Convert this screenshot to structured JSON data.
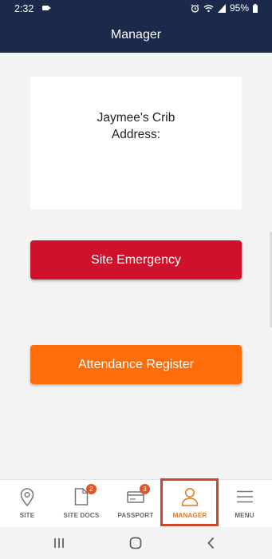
{
  "status_bar": {
    "time": "2:32",
    "battery": "95%",
    "icons": [
      "video-record-icon",
      "alarm-icon",
      "wifi-icon",
      "signal-icon",
      "battery-icon"
    ]
  },
  "header": {
    "title": "Manager"
  },
  "site_card": {
    "site_name": "Jaymee's Crib",
    "address_label": "Address:"
  },
  "buttons": {
    "emergency": "Site Emergency",
    "attendance": "Attendance Register"
  },
  "bottom_nav": {
    "items": [
      {
        "label": "SITE",
        "icon": "location-pin-icon"
      },
      {
        "label": "SITE DOCS",
        "icon": "document-icon",
        "badge": "2"
      },
      {
        "label": "PASSPORT",
        "icon": "card-icon",
        "badge": "3"
      },
      {
        "label": "MANAGER",
        "icon": "person-icon",
        "active": true
      },
      {
        "label": "MENU",
        "icon": "hamburger-icon"
      }
    ]
  },
  "colors": {
    "header_bg": "#1b2a4a",
    "emergency": "#d0112b",
    "attendance": "#ff6d0a",
    "active_tab": "#e07a21",
    "badge": "#e0552c",
    "highlight": "#c9472a"
  },
  "system_nav": {
    "icons": [
      "recent-apps-icon",
      "home-icon",
      "back-icon"
    ]
  }
}
